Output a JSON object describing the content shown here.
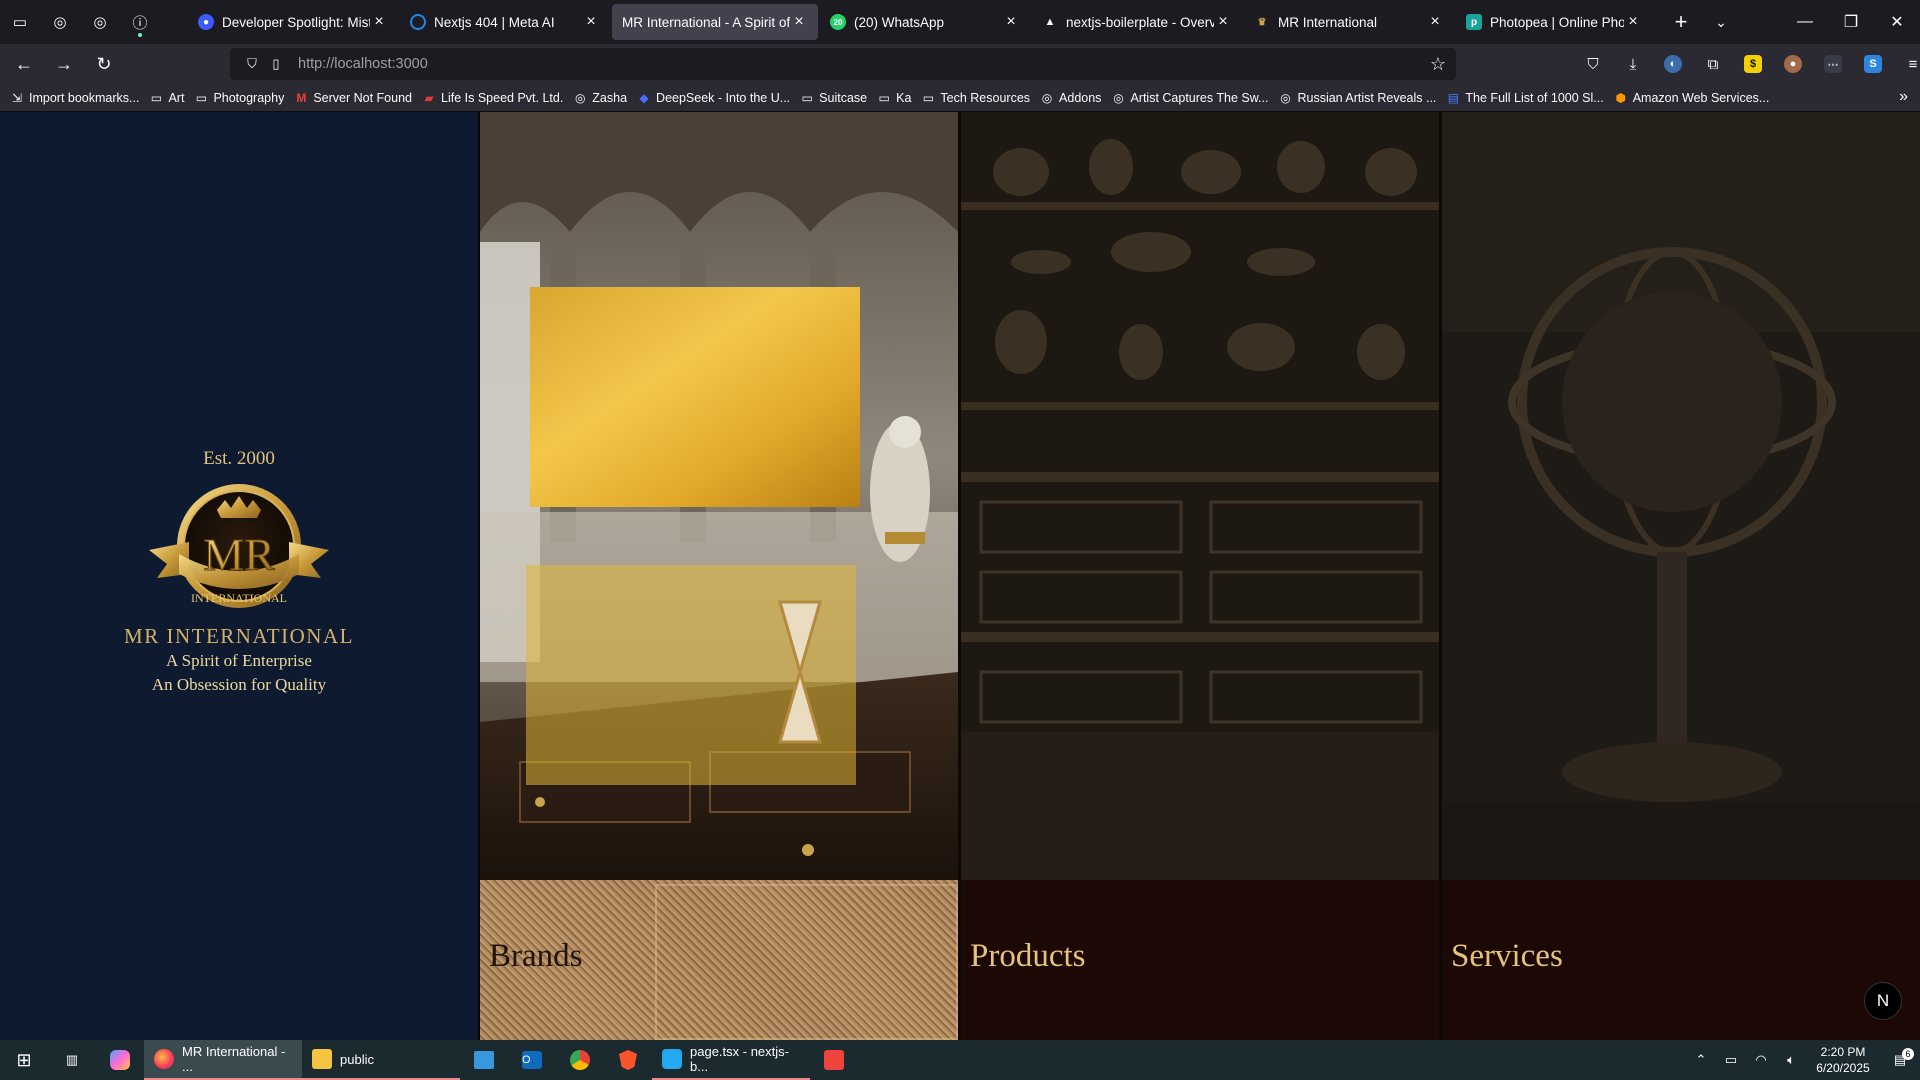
{
  "browser": {
    "tabs": [
      {
        "title": "Developer Spotlight: MisterP",
        "favicon_color": "#3d5afe",
        "active": false
      },
      {
        "title": "Nextjs 404 | Meta AI",
        "favicon_color": "#1e88e5",
        "active": false
      },
      {
        "title": "MR International - A Spirit of Ente",
        "favicon_color": "#c9a24c",
        "active": true
      },
      {
        "title": "(20) WhatsApp",
        "favicon_color": "#25d366",
        "active": false
      },
      {
        "title": "nextjs-boilerplate - Overview",
        "favicon_color": "#ffffff",
        "active": false
      },
      {
        "title": "MR International",
        "favicon_color": "#c9a24c",
        "active": false
      },
      {
        "title": "Photopea | Online Photo Edit",
        "favicon_color": "#18a497",
        "active": false
      }
    ],
    "url_host": "http://localhost",
    "url_port": ":3000",
    "bookmarks": [
      {
        "label": "Import bookmarks...",
        "icon": "import-icon"
      },
      {
        "label": "Art",
        "icon": "folder-icon"
      },
      {
        "label": "Photography",
        "icon": "folder-icon"
      },
      {
        "label": "Server Not Found",
        "icon": "gmail-icon"
      },
      {
        "label": "Life Is Speed Pvt. Ltd.",
        "icon": "site-icon"
      },
      {
        "label": "Zasha",
        "icon": "globe-icon"
      },
      {
        "label": "DeepSeek - Into the U...",
        "icon": "deepseek-icon"
      },
      {
        "label": "Suitcase",
        "icon": "folder-icon"
      },
      {
        "label": "Ka",
        "icon": "folder-icon"
      },
      {
        "label": "Tech Resources",
        "icon": "folder-icon"
      },
      {
        "label": "Addons",
        "icon": "globe-icon"
      },
      {
        "label": "Artist Captures The Sw...",
        "icon": "globe-icon"
      },
      {
        "label": "Russian Artist Reveals ...",
        "icon": "globe-icon"
      },
      {
        "label": "The Full List of 1000 Sl...",
        "icon": "doc-icon"
      },
      {
        "label": "Amazon Web Services...",
        "icon": "aws-icon"
      }
    ]
  },
  "site": {
    "est": "Est. 2000",
    "emblem_text": "MR",
    "emblem_ribbon": "INTERNATIONAL",
    "brand_name": "MR INTERNATIONAL",
    "tagline_1": "A Spirit of Enterprise",
    "tagline_2": "An Obsession for Quality",
    "columns": [
      {
        "label": "Brands"
      },
      {
        "label": "Products"
      },
      {
        "label": "Services"
      }
    ],
    "nextjs_badge": "N"
  },
  "taskbar": {
    "apps": [
      {
        "label": "MR International - ...",
        "active": true
      },
      {
        "label": "public",
        "active": false
      },
      {
        "label": "page.tsx - nextjs-b...",
        "active": false
      }
    ],
    "time": "2:20 PM",
    "date": "6/20/2025",
    "notification_count": "6"
  },
  "colors": {
    "accent_gold": "#d4b16a",
    "navy": "#0e1a30",
    "maroon_footer": "#1c0905"
  }
}
